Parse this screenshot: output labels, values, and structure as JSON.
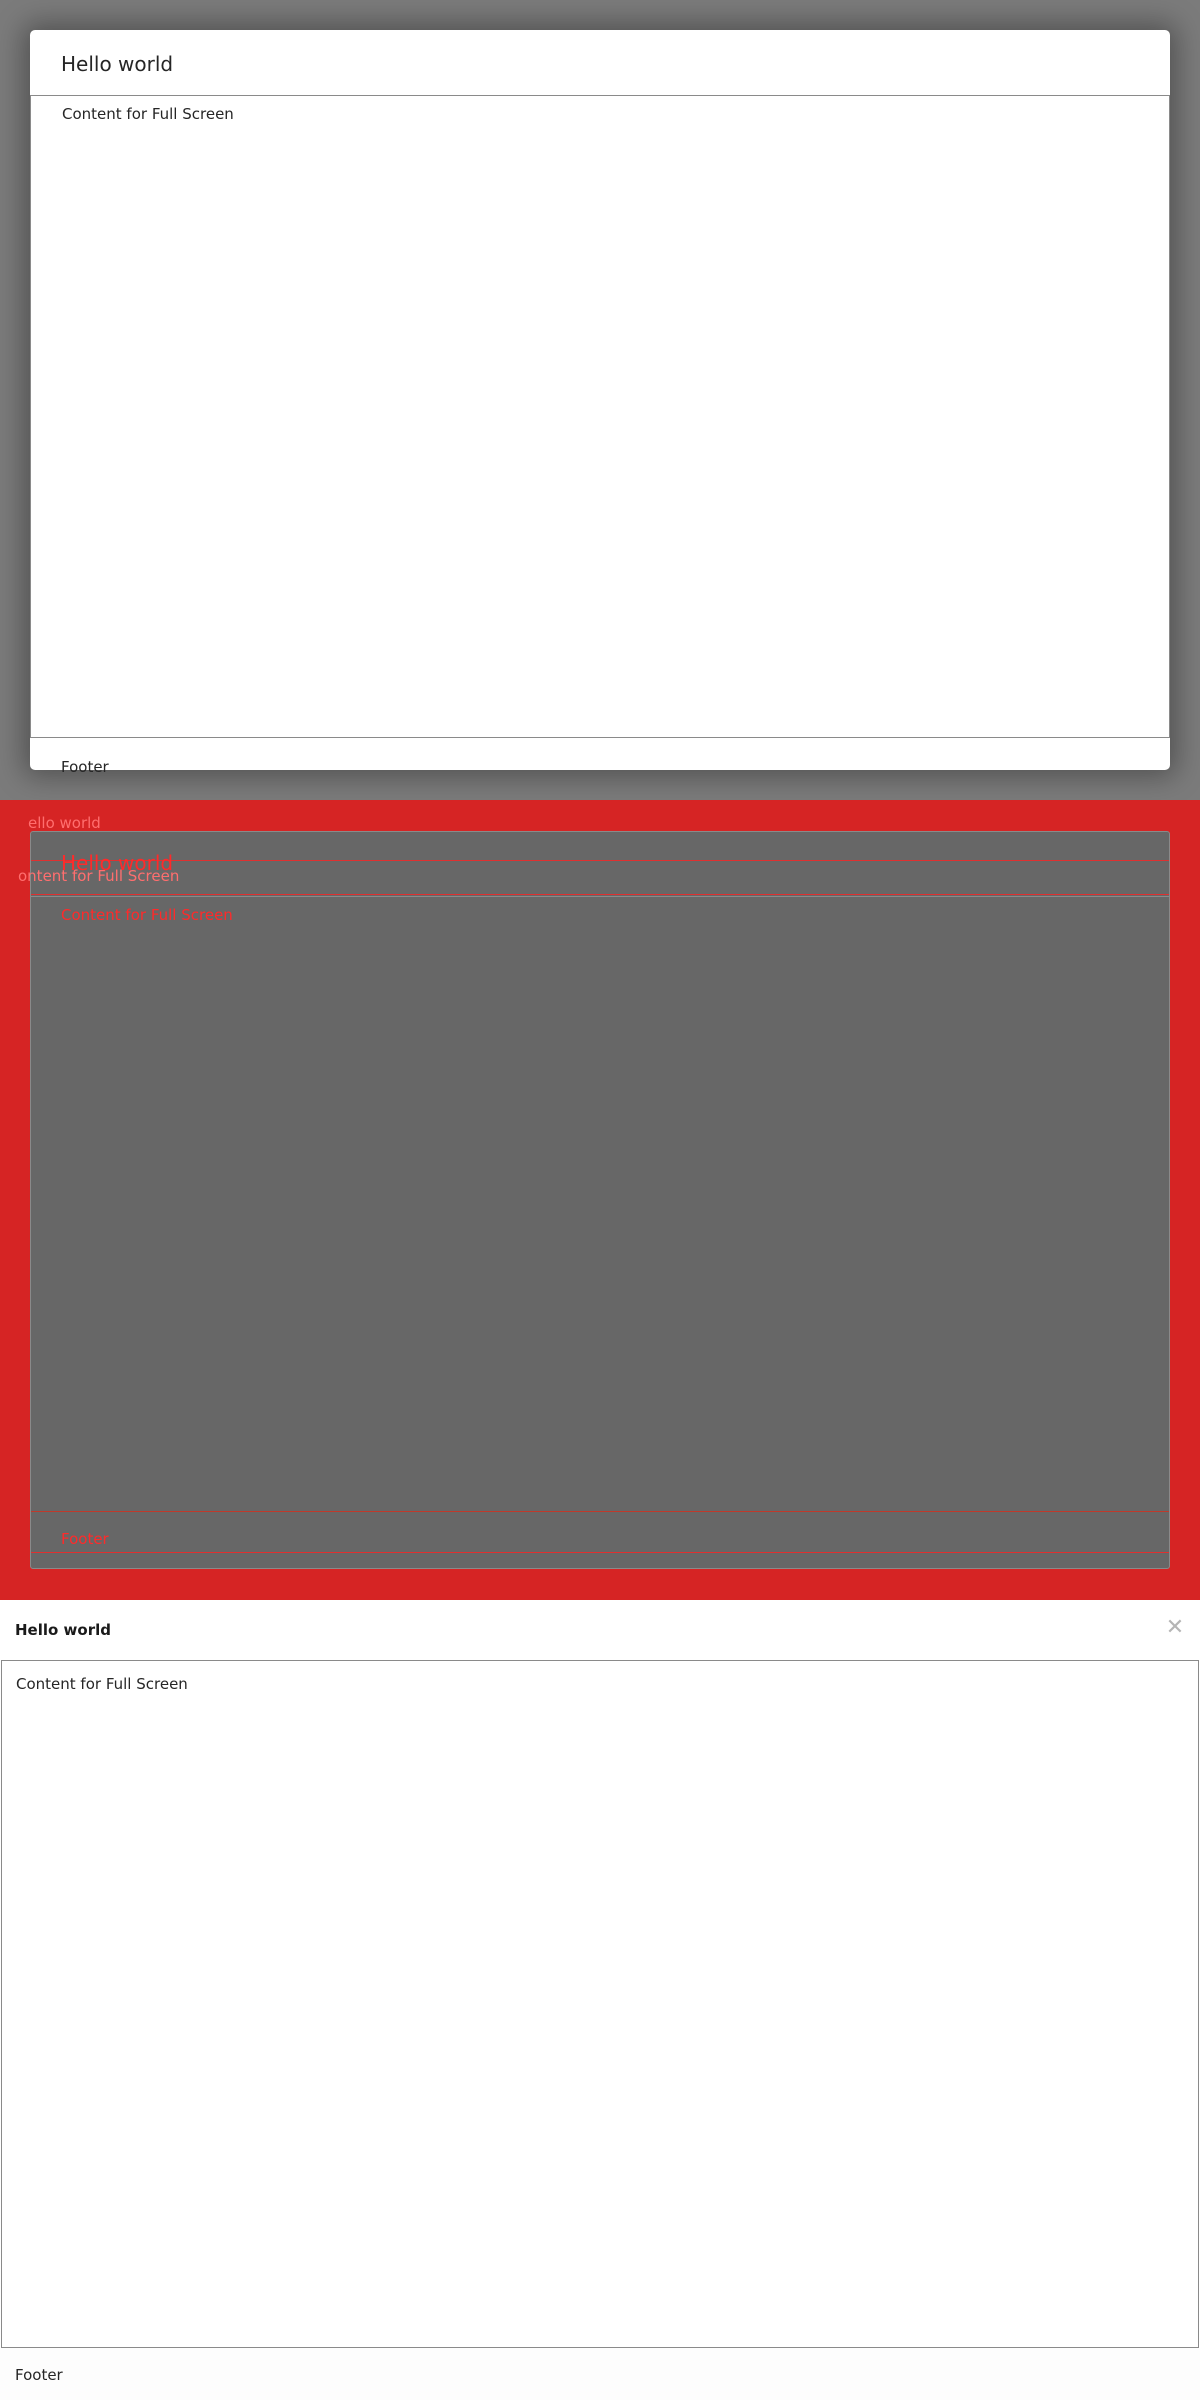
{
  "panel1": {
    "title": "Hello world",
    "content": "Content for Full Screen",
    "footer": "Footer"
  },
  "panel2": {
    "title": "Hello world",
    "content": "Content for Full Screen",
    "footer": "Footer",
    "ghost_title": "ello world",
    "ghost_content": "ontent for Full Screen",
    "backdrop_color": "#d62424",
    "text_color": "#e01010"
  },
  "panel3": {
    "title": "Hello world",
    "close_glyph": "✕",
    "content": "Content for Full Screen",
    "footer": "Footer"
  },
  "icons": {
    "close": "close-icon"
  }
}
